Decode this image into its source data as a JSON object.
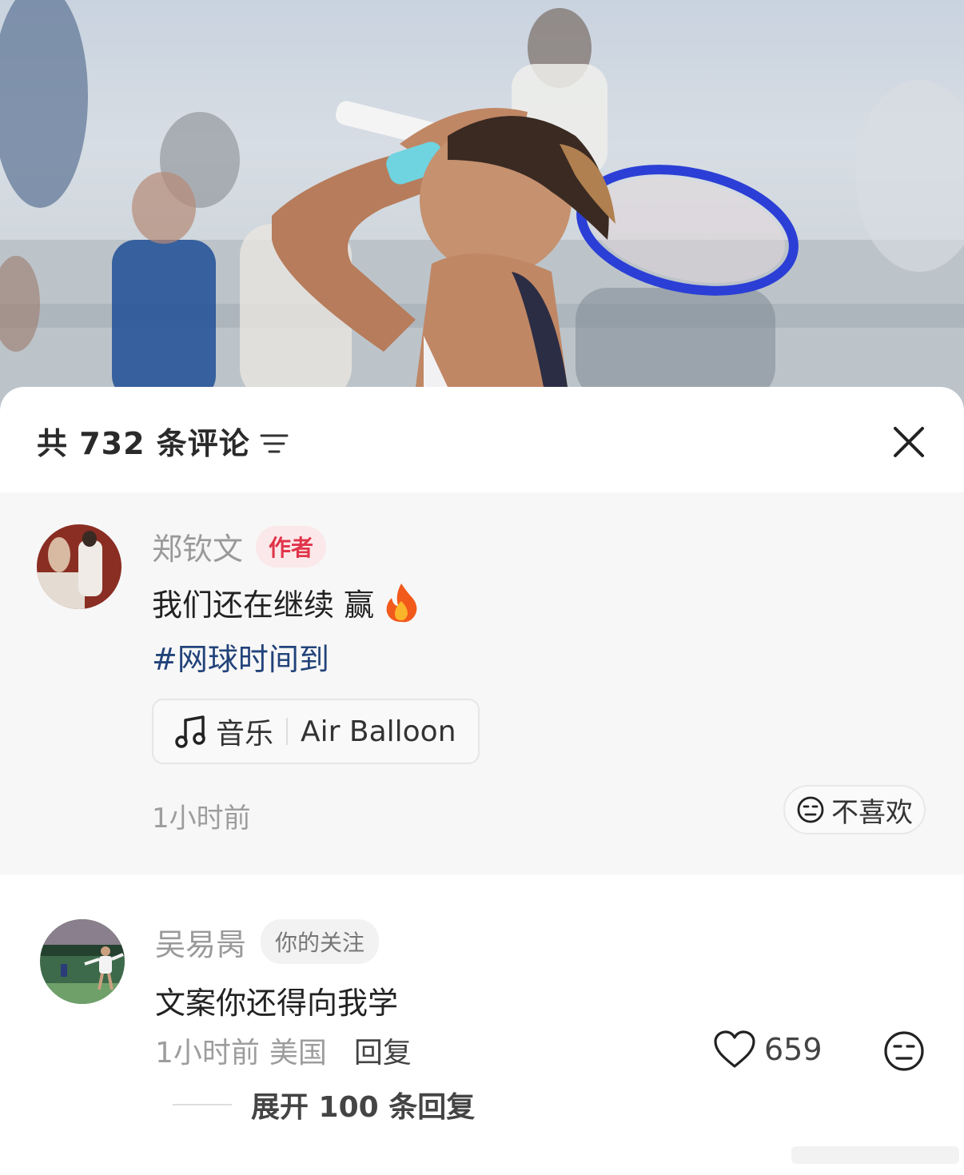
{
  "header": {
    "comment_count_title": "共 732 条评论"
  },
  "author_comment": {
    "username": "郑钦文",
    "badge": "作者",
    "text": "我们还在继续 赢",
    "hashtag": "#网球时间到",
    "music_label": "音乐",
    "music_title": "Air Balloon",
    "time": "1小时前",
    "dislike_label": "不喜欢"
  },
  "reply_comment": {
    "username": "吴易昺",
    "badge": "你的关注",
    "text": "文案你还得向我学",
    "time": "1小时前",
    "location": "美国",
    "reply_label": "回复",
    "like_count": "659",
    "expand_label": "展开 100 条回复"
  },
  "colors": {
    "author_badge_text": "#e0344a",
    "hashtag": "#22437a",
    "racket": "#2b3fd6",
    "wristband": "#6fd3e0"
  },
  "icons": [
    "filter-icon",
    "close-icon",
    "fire-icon",
    "music-note-icon",
    "dislike-face-icon",
    "heart-icon"
  ]
}
